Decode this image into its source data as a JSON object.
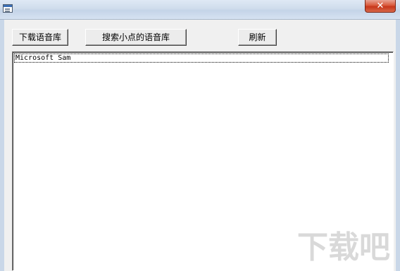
{
  "window": {
    "title": "",
    "close_label": "✕",
    "app_icon": "window-app-icon"
  },
  "toolbar": {
    "download_label": "下载语音库",
    "search_label": "搜索小点的语音库",
    "refresh_label": "刷新"
  },
  "voice_list": {
    "items": [
      "Microsoft Sam"
    ]
  },
  "watermark": {
    "text": "下载吧"
  },
  "colors": {
    "titlebar": "#cfdcec",
    "close": "#c7371b",
    "background": "#f0f0f0",
    "list_bg": "#ffffff"
  }
}
